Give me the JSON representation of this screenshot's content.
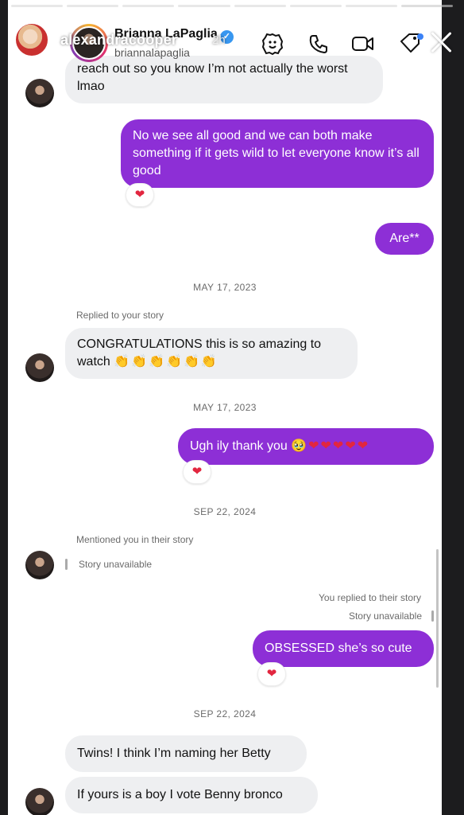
{
  "story": {
    "username": "alexandracooper",
    "time": "2h",
    "progress_total": 8,
    "progress_done": 7
  },
  "chat_header": {
    "name": "Brianna LaPaglia",
    "handle": "briannalapaglia",
    "icons": [
      "sticker-icon",
      "phone-icon",
      "video-icon",
      "tag-icon"
    ]
  },
  "messages": {
    "m1": "reach out so you know I’m not actually the worst lmao",
    "m2": "No we see all good and we can both make something if it gets wild to let everyone know it’s all good",
    "m2_react": "❤",
    "m3": "Are**",
    "date1": "MAY 17, 2023",
    "replied1": "Replied to your story",
    "m4_text": "CONGRATULATIONS this is so amazing to watch ",
    "m4_emoji": "👏👏👏👏👏👏",
    "date2": "MAY 17, 2023",
    "m5_text": "Ugh ily thank you ",
    "m5_emoji": "🥹❤❤❤❤❤",
    "m5_react": "❤",
    "date3": "SEP 22, 2024",
    "mentioned": "Mentioned you in their story",
    "story_unavail_1": "Story unavailable",
    "you_replied": "You replied to their story",
    "story_unavail_2": "Story unavailable",
    "m6": "OBSESSED she’s so cute",
    "m6_react": "❤",
    "date4": "SEP 22, 2024",
    "m7": "Twins! I think I’m naming her Betty",
    "m8": "If yours is a boy I vote Benny bronco"
  },
  "colors": {
    "outgoing_bubble": "#8d2fd6",
    "incoming_bubble": "#eeeff1",
    "verified": "#3897f0",
    "heart": "#e2263f"
  }
}
